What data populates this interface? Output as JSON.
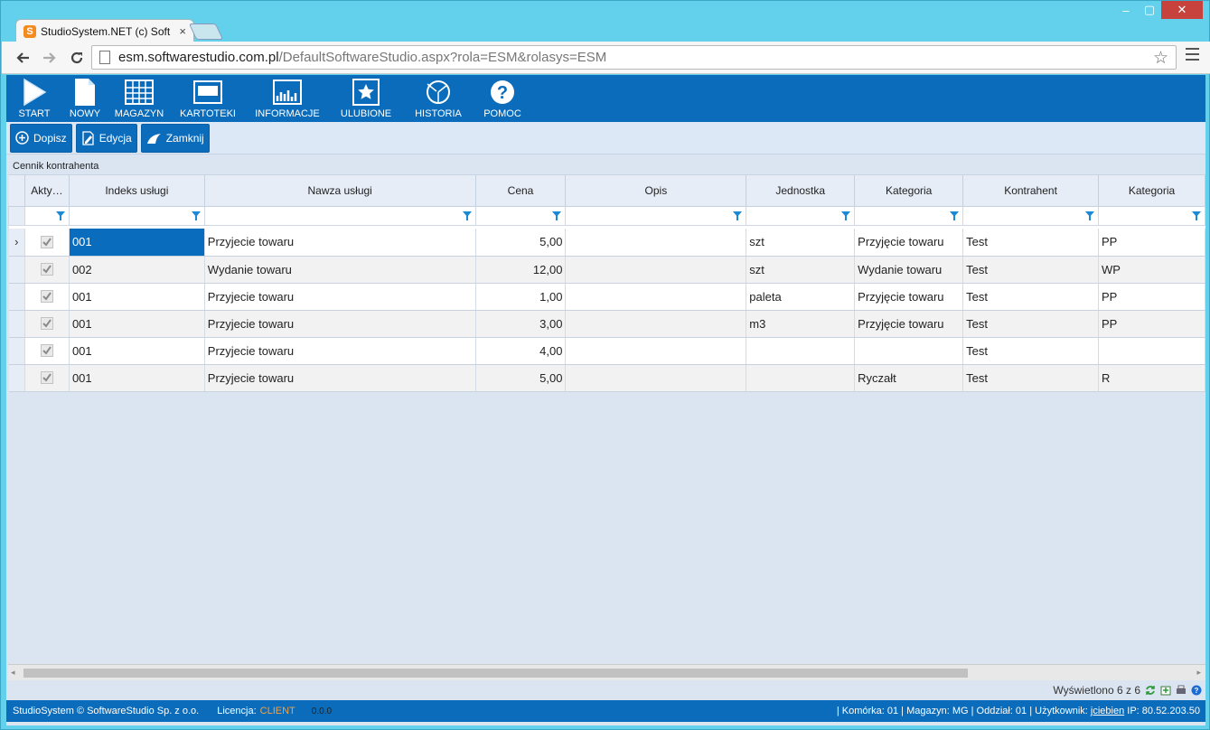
{
  "window": {
    "min": "–",
    "max": "▢",
    "close": "✕"
  },
  "tab": {
    "favicon": "S",
    "title": "StudioSystem.NET (c) Soft",
    "close": "×"
  },
  "address": {
    "host": "esm.softwarestudio.com.pl",
    "path": "/DefaultSoftwareStudio.aspx?rola=ESM&rolasys=ESM"
  },
  "ribbon": {
    "items": [
      {
        "label": "START",
        "icon": "play-icon"
      },
      {
        "label": "NOWY",
        "icon": "document-icon"
      },
      {
        "label": "MAGAZYN",
        "icon": "grid-icon"
      },
      {
        "label": "KARTOTEKI",
        "icon": "window-icon"
      },
      {
        "label": "INFORMACJE",
        "icon": "chart-icon"
      },
      {
        "label": "ULUBIONE",
        "icon": "star-icon"
      },
      {
        "label": "HISTORIA",
        "icon": "history-icon"
      },
      {
        "label": "POMOC",
        "icon": "help-icon"
      }
    ]
  },
  "actions": {
    "add": "Dopisz",
    "edit": "Edycja",
    "close": "Zamknij"
  },
  "panel": {
    "title": "Cennik kontrahenta"
  },
  "grid": {
    "columns": [
      "Akty…",
      "Indeks usługi",
      "Nawza usługi",
      "Cena",
      "Opis",
      "Jednostka",
      "Kategoria",
      "Kontrahent",
      "Kategoria"
    ],
    "rows": [
      {
        "indicator": "›",
        "index": "001",
        "name": "Przyjecie towaru",
        "price": "5,00",
        "desc": "",
        "unit": "szt",
        "category": "Przyjęcie towaru",
        "contractor": "Test",
        "category2": "PP"
      },
      {
        "indicator": "",
        "index": "002",
        "name": "Wydanie towaru",
        "price": "12,00",
        "desc": "",
        "unit": "szt",
        "category": "Wydanie towaru",
        "contractor": "Test",
        "category2": "WP"
      },
      {
        "indicator": "",
        "index": "001",
        "name": "Przyjecie towaru",
        "price": "1,00",
        "desc": "",
        "unit": "paleta",
        "category": "Przyjęcie towaru",
        "contractor": "Test",
        "category2": "PP"
      },
      {
        "indicator": "",
        "index": "001",
        "name": "Przyjecie towaru",
        "price": "3,00",
        "desc": "",
        "unit": "m3",
        "category": "Przyjęcie towaru",
        "contractor": "Test",
        "category2": "PP"
      },
      {
        "indicator": "",
        "index": "001",
        "name": "Przyjecie towaru",
        "price": "4,00",
        "desc": "",
        "unit": "",
        "category": "",
        "contractor": "Test",
        "category2": ""
      },
      {
        "indicator": "",
        "index": "001",
        "name": "Przyjecie towaru",
        "price": "5,00",
        "desc": "",
        "unit": "",
        "category": "Ryczałt",
        "contractor": "Test",
        "category2": "R"
      }
    ]
  },
  "scroll": {
    "left": "◂",
    "right": "▸"
  },
  "status": {
    "shown": "Wyświetlono 6 z 6"
  },
  "footer": {
    "copyright": "StudioSystem © SoftwareStudio Sp. z o.o.",
    "license_label": "Licencja:",
    "license_value": "CLIENT",
    "version": "0.0.0",
    "cell_text": "| Komórka: 01 | Magazyn: MG | Oddział: 01 | Użytkownik:",
    "user": "jciebien",
    "ip": "IP: 80.52.203.50"
  },
  "colors": {
    "ribbon": "#0a6cba",
    "selected_cell": "#0a6cbc",
    "license": "#f8a040"
  }
}
